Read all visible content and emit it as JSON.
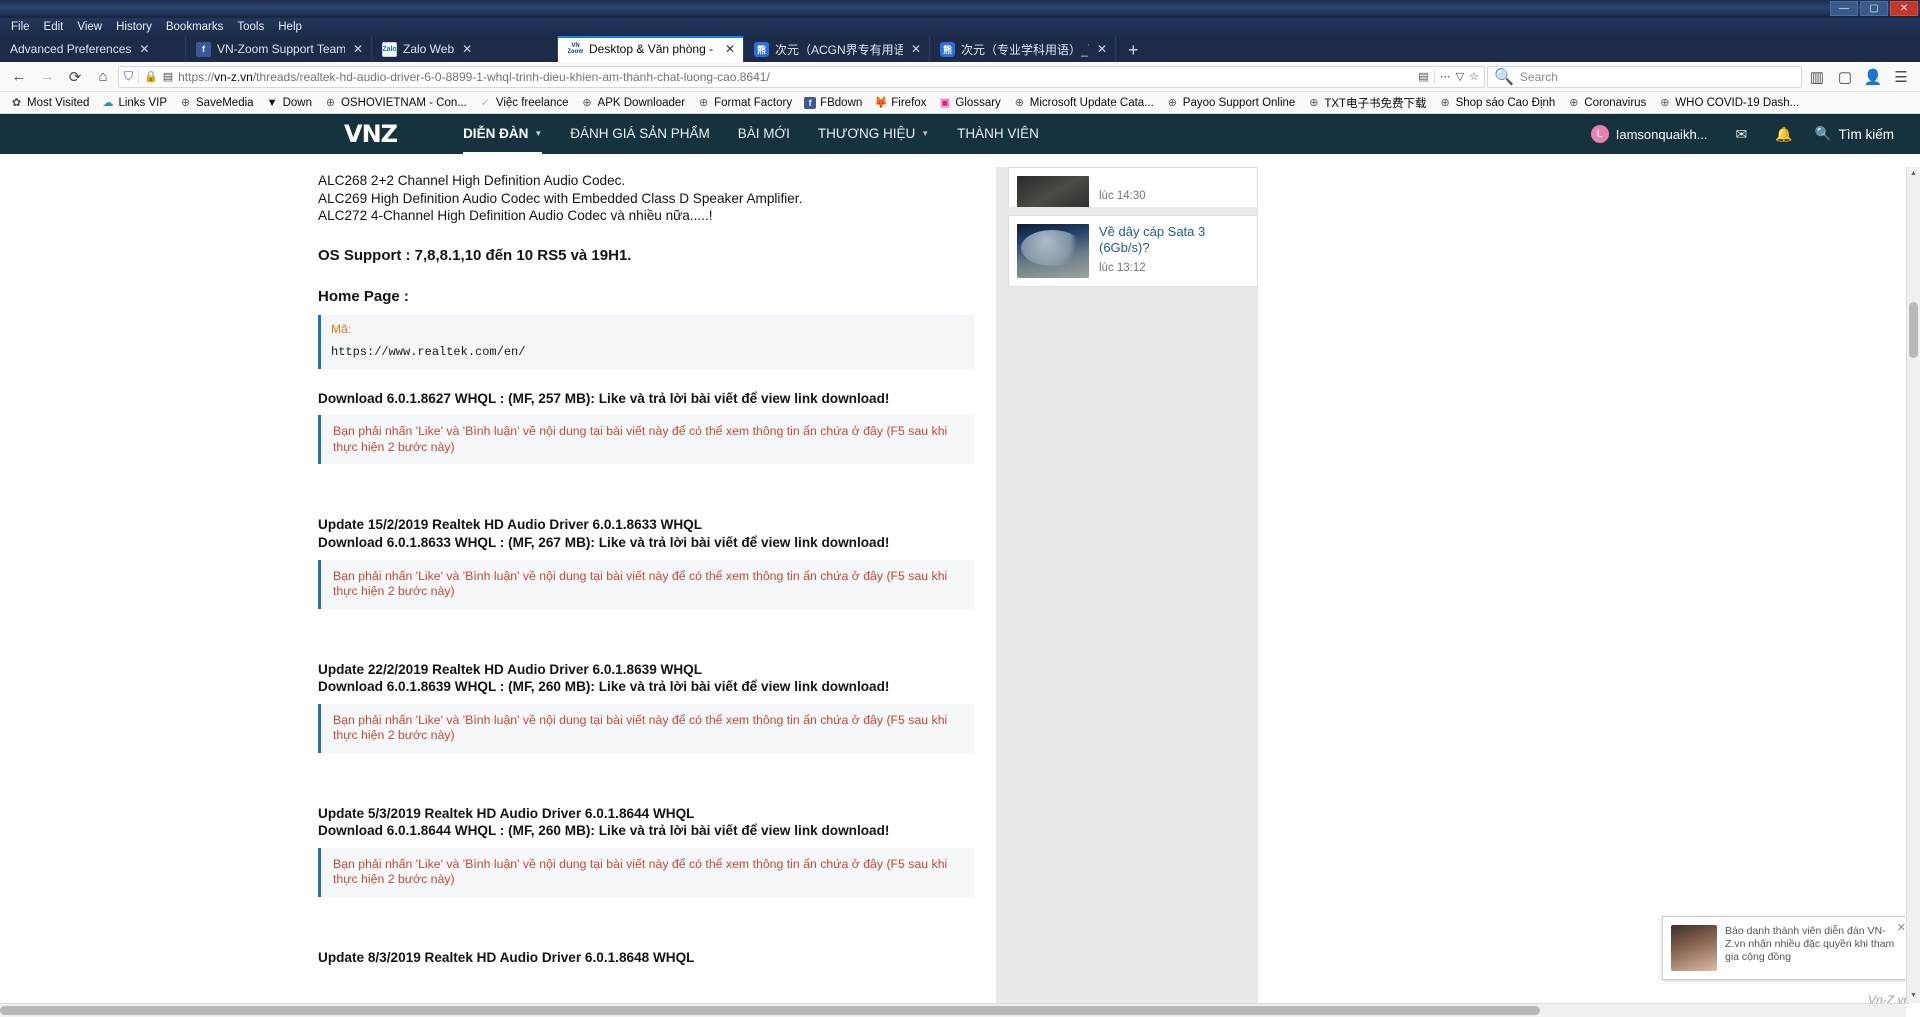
{
  "window": {
    "minimize": "—",
    "maximize": "▢",
    "close": "✕"
  },
  "menubar": {
    "items": [
      "File",
      "Edit",
      "View",
      "History",
      "Bookmarks",
      "Tools",
      "Help"
    ]
  },
  "tabs": [
    {
      "title": "Advanced Preferences",
      "favicon": "none",
      "active": false,
      "close": "✕"
    },
    {
      "title": "VN-Zoom Support Team",
      "favicon": "facebook-icon",
      "active": false,
      "close": "✕"
    },
    {
      "title": "Zalo Web",
      "favicon": "zalo-icon",
      "active": false,
      "close": "✕"
    },
    {
      "title": "Desktop & Văn phòng - Realtek",
      "favicon": "vnzoom-icon",
      "active": true,
      "close": "✕"
    },
    {
      "title": "次元（ACGN界专有用语）_百度",
      "favicon": "baidu-icon",
      "active": false,
      "close": "✕"
    },
    {
      "title": "次元（专业学科用语）_百度百科",
      "favicon": "baidu-icon",
      "active": false,
      "close": "✕"
    }
  ],
  "newtab_label": "+",
  "navbar": {
    "back": "←",
    "forward": "→",
    "reload": "⟳",
    "home": "⌂",
    "shield": "shield-icon",
    "lock": "🔒",
    "reader": "reader-icon",
    "url_prefix": "https://",
    "url_host": "vn-z.vn",
    "url_path": "/threads/realtek-hd-audio-driver-6-0-8899-1-whql-trinh-dieu-khien-am-thanh-chat-luong-cao.8641/",
    "page_action": "▤",
    "menu_dots": "⋯",
    "pocket": "▽",
    "bookmark_star": "☆",
    "search_icon": "🔍",
    "search_placeholder": "Search",
    "library": "▥",
    "sidebar": "▢",
    "account": "👤",
    "hamburger": "☰"
  },
  "bookmarks": [
    {
      "label": "Most Visited",
      "icon": "gear-icon"
    },
    {
      "label": "Links VIP",
      "icon": "cloud-icon"
    },
    {
      "label": "SaveMedia",
      "icon": "globe-icon"
    },
    {
      "label": "Down",
      "icon": "down-icon"
    },
    {
      "label": "OSHOVIETNAM - Con...",
      "icon": "globe-icon"
    },
    {
      "label": "Việc freelance",
      "icon": "check-icon"
    },
    {
      "label": "APK Downloader",
      "icon": "globe-icon"
    },
    {
      "label": "Format Factory",
      "icon": "globe-icon"
    },
    {
      "label": "FBdown",
      "icon": "facebook-icon"
    },
    {
      "label": "Firefox",
      "icon": "firefox-icon"
    },
    {
      "label": "Glossary",
      "icon": "pink-icon"
    },
    {
      "label": "Microsoft Update Cata...",
      "icon": "globe-icon"
    },
    {
      "label": "Payoo Support Online",
      "icon": "globe-icon"
    },
    {
      "label": "TXT电子书免费下载",
      "icon": "globe-icon"
    },
    {
      "label": "Shop sáo Cao Định",
      "icon": "globe-icon"
    },
    {
      "label": "Coronavirus",
      "icon": "globe-icon"
    },
    {
      "label": "WHO COVID-19 Dash...",
      "icon": "globe-icon"
    }
  ],
  "site_header": {
    "logo": "VNZ",
    "nav": [
      {
        "label": "DIỄN ĐÀN",
        "caret": true,
        "selected": true
      },
      {
        "label": "ĐÁNH GIÁ SẢN PHẨM",
        "caret": false,
        "selected": false
      },
      {
        "label": "BÀI MỚI",
        "caret": false,
        "selected": false
      },
      {
        "label": "THƯƠNG HIỆU",
        "caret": true,
        "selected": false
      },
      {
        "label": "THÀNH VIÊN",
        "caret": false,
        "selected": false
      }
    ],
    "user": {
      "avatar_letter": "L",
      "name": "Iamsonquaikh..."
    },
    "mail_icon": "✉",
    "bell_icon": "🔔",
    "search_label": "Tìm kiếm",
    "search_icon": "🔍"
  },
  "post": {
    "codec_lines": [
      "ALC268 2+2 Channel High Definition Audio Codec.",
      "ALC269 High Definition Audio Codec with Embedded Class D Speaker Amplifier.",
      "ALC272 4-Channel High Definition Audio Codec và nhiều nữa.....!"
    ],
    "os_support": "OS Support : 7,8,8.1,10 đến 10 RS5 và 19H1.",
    "home_page_label": "Home Page :",
    "code_label": "Mã:",
    "code_value": "https://www.realtek.com/en/",
    "note_text": "Bạn phải nhấn 'Like' và 'Bình luận' về nội dung tại bài viết này để có thể xem thông tin ẩn chứa ở đây (F5 sau khi thực hiện 2 bước này)",
    "blocks": [
      {
        "update_title": "",
        "download_title": "Download 6.0.1.8627 WHQL : (MF, 257 MB): Like và trả lời bài viết để view link download!"
      },
      {
        "update_title": "Update 15/2/2019 Realtek HD Audio Driver 6.0.1.8633 WHQL",
        "download_title": "Download 6.0.1.8633 WHQL : (MF, 267 MB): Like và trả lời bài viết để view link download!"
      },
      {
        "update_title": "Update 22/2/2019 Realtek HD Audio Driver 6.0.1.8639 WHQL",
        "download_title": "Download 6.0.1.8639 WHQL : (MF, 260 MB): Like và trả lời bài viết để view link download!"
      },
      {
        "update_title": "Update 5/3/2019 Realtek HD Audio Driver 6.0.1.8644 WHQL",
        "download_title": "Download 6.0.1.8644 WHQL : (MF, 260 MB): Like và trả lời bài viết để view link download!"
      }
    ],
    "last_partial": "Update 8/3/2019 Realtek HD Audio Driver 6.0.1.8648 WHQL"
  },
  "right_rail": [
    {
      "title": "",
      "time": "lúc 14:30",
      "thumb": "photo-thumb-1"
    },
    {
      "title": "Về dây cáp Sata 3 (6Gb/s)?",
      "time": "lúc 13:12",
      "thumb": "photo-thumb-2"
    }
  ],
  "toast": {
    "text": "Báo danh thành viên diễn đàn VN-Z.vn nhận nhiều đặc quyền khi tham gia cộng đồng",
    "close": "✕"
  },
  "watermark": "Vn-Z.vn",
  "colors": {
    "site_header_bg": "#16323f",
    "accent_blue": "#2a6bb5",
    "note_red": "#c24a3a",
    "code_orange": "#d97a1a"
  }
}
